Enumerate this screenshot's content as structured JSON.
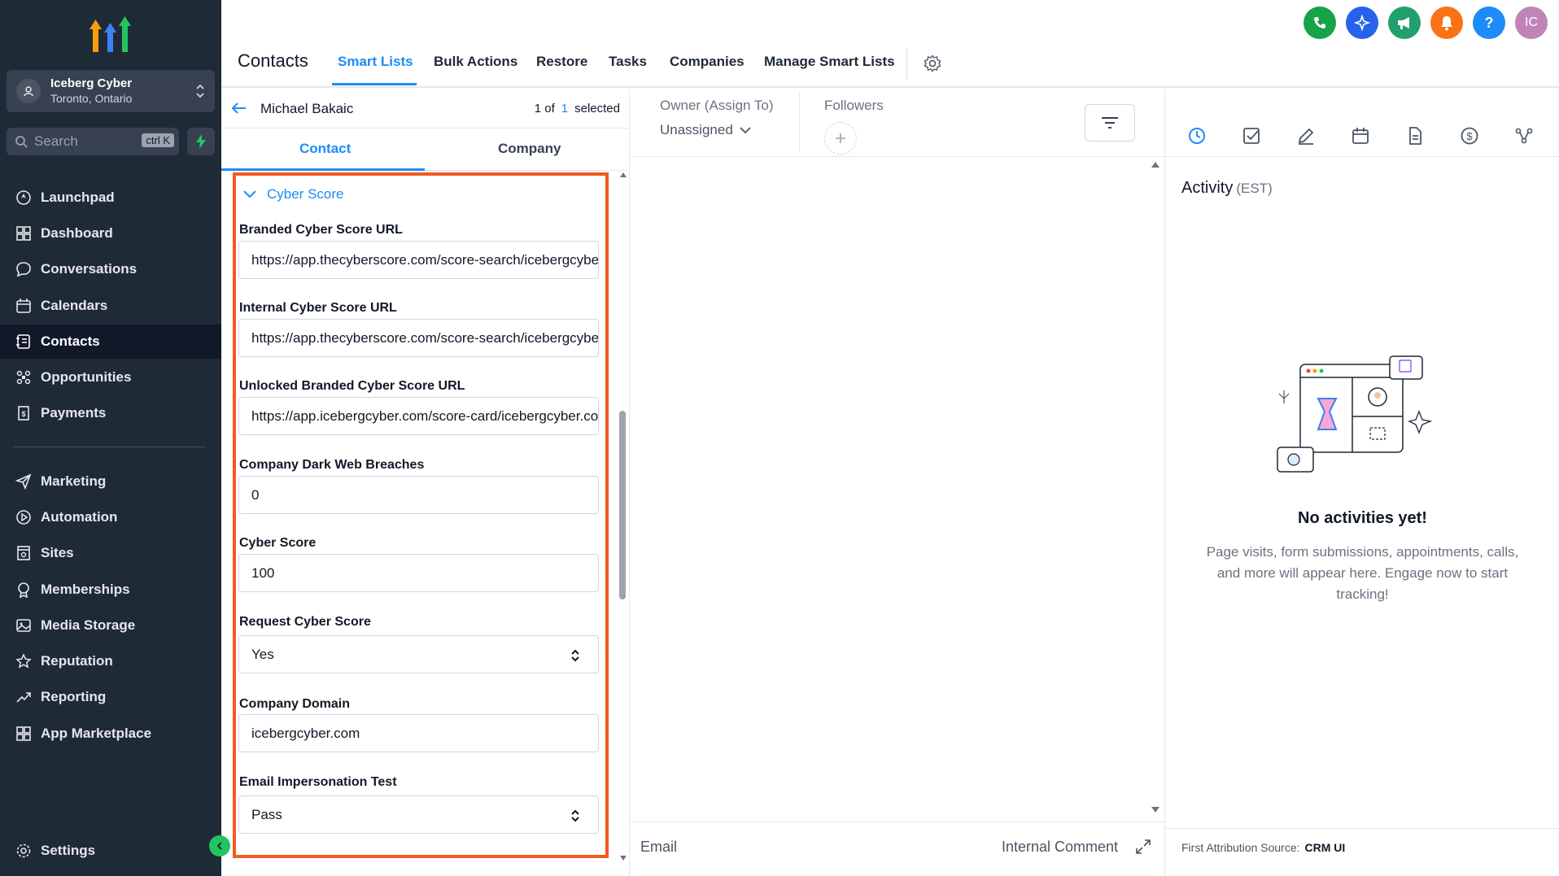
{
  "sidebar": {
    "account": {
      "name": "Iceberg Cyber",
      "location": "Toronto, Ontario"
    },
    "search": {
      "placeholder": "Search",
      "shortcut": "ctrl K"
    },
    "items": [
      {
        "label": "Launchpad",
        "icon": "launchpad-icon"
      },
      {
        "label": "Dashboard",
        "icon": "dashboard-icon"
      },
      {
        "label": "Conversations",
        "icon": "chat-icon"
      },
      {
        "label": "Calendars",
        "icon": "calendar-icon"
      },
      {
        "label": "Contacts",
        "icon": "contacts-icon",
        "active": true
      },
      {
        "label": "Opportunities",
        "icon": "opportunities-icon"
      },
      {
        "label": "Payments",
        "icon": "payments-icon"
      },
      {
        "label": "Marketing",
        "icon": "send-icon"
      },
      {
        "label": "Automation",
        "icon": "automation-icon"
      },
      {
        "label": "Sites",
        "icon": "sites-icon"
      },
      {
        "label": "Memberships",
        "icon": "award-icon"
      },
      {
        "label": "Media Storage",
        "icon": "image-icon"
      },
      {
        "label": "Reputation",
        "icon": "star-icon"
      },
      {
        "label": "Reporting",
        "icon": "trend-icon"
      },
      {
        "label": "App Marketplace",
        "icon": "grid-icon"
      }
    ],
    "settings_label": "Settings"
  },
  "header": {
    "title": "Contacts",
    "tabs": [
      "Smart Lists",
      "Bulk Actions",
      "Restore",
      "Tasks",
      "Companies",
      "Manage Smart Lists"
    ],
    "active_tab": "Smart Lists",
    "avatar_initials": "IC",
    "help_label": "?",
    "colors": {
      "phone": "#16a34a",
      "magic": "#2563eb",
      "announce": "#22a06b",
      "bell": "#f97316",
      "help": "#1d8cf8",
      "avatar": "#c084b8"
    }
  },
  "contact": {
    "name": "Michael Bakaic",
    "selection_prefix": "1 of",
    "selection_count": "1",
    "selection_suffix": "selected",
    "subtabs": [
      "Contact",
      "Company"
    ],
    "section_title": "Cyber Score",
    "fields": [
      {
        "label": "Branded Cyber Score URL",
        "value": "https://app.thecyberscore.com/score-search/icebergcyber.com",
        "type": "text"
      },
      {
        "label": "Internal Cyber Score URL",
        "value": "https://app.thecyberscore.com/score-search/icebergcyber.com",
        "type": "text"
      },
      {
        "label": "Unlocked Branded Cyber Score URL",
        "value": "https://app.icebergcyber.com/score-card/icebergcyber.com",
        "type": "text"
      },
      {
        "label": "Company Dark Web Breaches",
        "value": "0",
        "type": "text"
      },
      {
        "label": "Cyber Score",
        "value": "100",
        "type": "text"
      },
      {
        "label": "Request Cyber Score",
        "value": "Yes",
        "type": "select"
      },
      {
        "label": "Company Domain",
        "value": "icebergcyber.com",
        "type": "text"
      },
      {
        "label": "Email Impersonation Test",
        "value": "Pass",
        "type": "select"
      }
    ]
  },
  "center": {
    "owner_label": "Owner (Assign To)",
    "owner_value": "Unassigned",
    "followers_label": "Followers",
    "bottom_tabs": {
      "email": "Email",
      "comment": "Internal Comment"
    }
  },
  "activity": {
    "title": "Activity",
    "timezone": "(EST)",
    "empty_title": "No activities yet!",
    "empty_desc": "Page visits, form submissions, appointments, calls, and more will appear here. Engage now to start tracking!",
    "attribution_label": "First Attribution Source:",
    "attribution_value": "CRM UI",
    "accent": "#1d8cf8"
  }
}
